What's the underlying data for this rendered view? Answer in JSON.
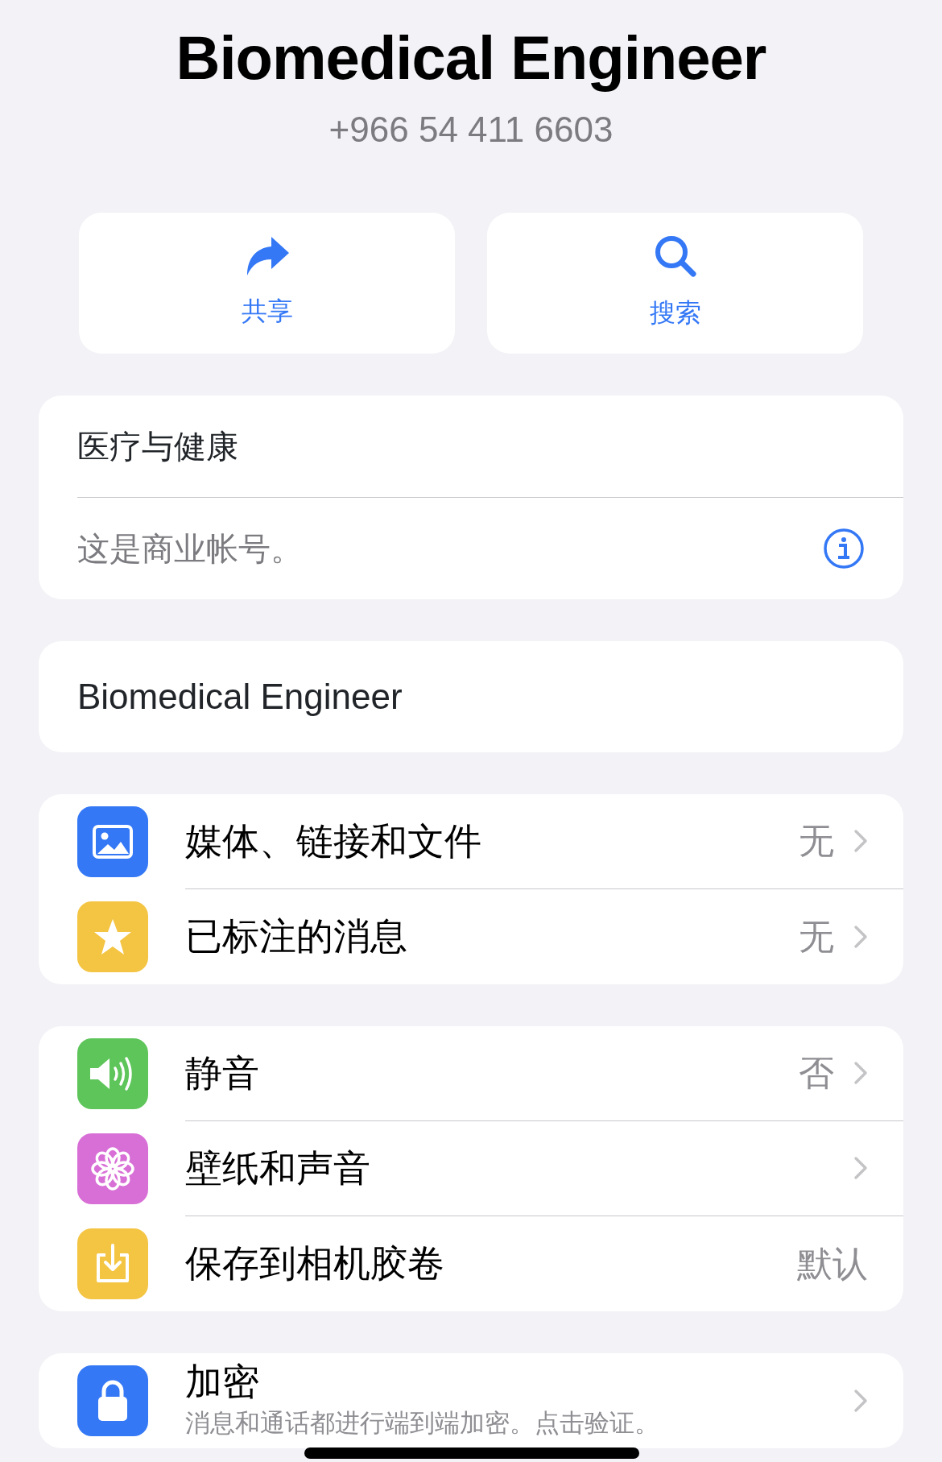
{
  "header": {
    "title": "Biomedical Engineer",
    "phone": "+966 54 411 6603"
  },
  "actions": [
    {
      "kind": "share",
      "label": "共享"
    },
    {
      "kind": "search",
      "label": "搜索"
    }
  ],
  "business": {
    "category": "医疗与健康",
    "note": "这是商业帐号。"
  },
  "bio": {
    "text": "Biomedical Engineer"
  },
  "sections": [
    {
      "rows": [
        {
          "kind": "media",
          "color": "#3478f6",
          "label": "媒体、链接和文件",
          "value": "无",
          "chevron": true
        },
        {
          "kind": "star",
          "color": "#f4c443",
          "label": "已标注的消息",
          "value": "无",
          "chevron": true
        }
      ]
    },
    {
      "rows": [
        {
          "kind": "speaker",
          "color": "#5ec55a",
          "label": "静音",
          "value": "否",
          "chevron": true
        },
        {
          "kind": "flower",
          "color": "#d86fd6",
          "label": "壁纸和声音",
          "chevron": true
        },
        {
          "kind": "download",
          "color": "#f4c443",
          "label": "保存到相机胶卷",
          "value": "默认",
          "chevron": false
        }
      ]
    },
    {
      "rows": [
        {
          "kind": "lock",
          "color": "#3478f6",
          "label": "加密",
          "subtitle": "消息和通话都进行端到端加密。点击验证。",
          "chevron": true
        }
      ]
    }
  ]
}
